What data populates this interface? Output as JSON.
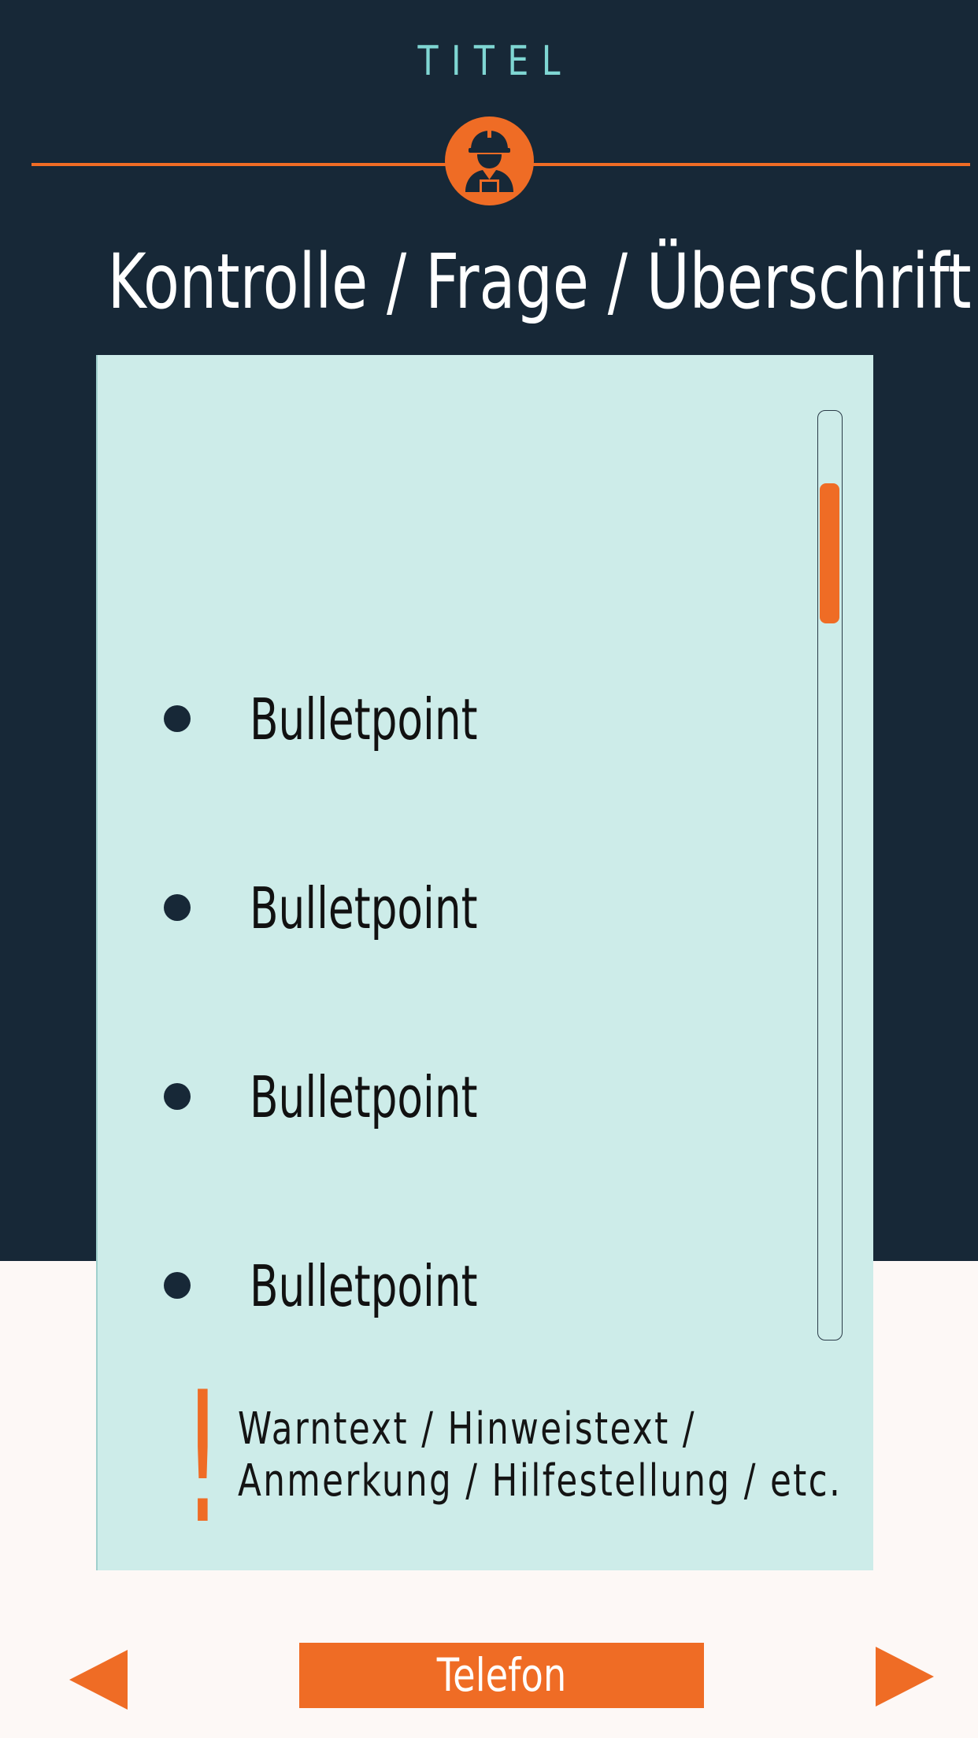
{
  "app_title": "TITEL",
  "badge_icon": "construction-worker-icon",
  "heading": "Kontrolle / Frage / Überschrift",
  "bullets": [
    {
      "label": "Bulletpoint"
    },
    {
      "label": "Bulletpoint"
    },
    {
      "label": "Bulletpoint"
    },
    {
      "label": "Bulletpoint"
    }
  ],
  "warning": {
    "mark": "!",
    "line1": "Warntext / Hinweistext /",
    "line2": "Anmerkung / Hilfestellung / etc."
  },
  "footer": {
    "phone_label": "Telefon",
    "prev_icon": "triangle-left-icon",
    "next_icon": "triangle-right-icon"
  },
  "colors": {
    "dark_navy": "#172837",
    "accent_orange": "#ef6c25",
    "title_teal": "#7fd6d3",
    "card_mint": "#cdece9",
    "page_cream": "#fdf8f6"
  }
}
